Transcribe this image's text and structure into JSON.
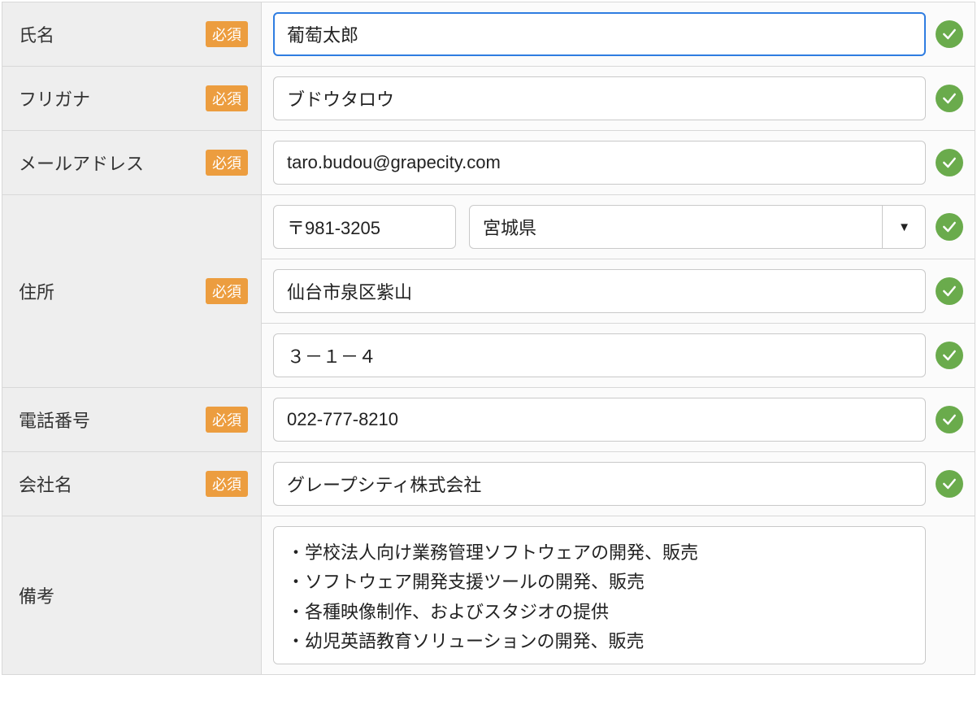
{
  "badges": {
    "required": "必須"
  },
  "fields": {
    "name": {
      "label": "氏名",
      "value": "葡萄太郎"
    },
    "furigana": {
      "label": "フリガナ",
      "value": "ブドウタロウ"
    },
    "email": {
      "label": "メールアドレス",
      "value": "taro.budou@grapecity.com"
    },
    "address": {
      "label": "住所",
      "postal": "〒981-3205",
      "prefecture": "宮城県",
      "city": "仙台市泉区紫山",
      "street": "３－１－４"
    },
    "phone": {
      "label": "電話番号",
      "value": "022-777-8210"
    },
    "company": {
      "label": "会社名",
      "value": "グレープシティ株式会社"
    },
    "notes": {
      "label": "備考",
      "value": "・学校法人向け業務管理ソフトウェアの開発、販売\n・ソフトウェア開発支援ツールの開発、販売\n・各種映像制作、およびスタジオの提供\n・幼児英語教育ソリューションの開発、販売"
    }
  },
  "icons": {
    "dropdown_caret": "▼"
  }
}
